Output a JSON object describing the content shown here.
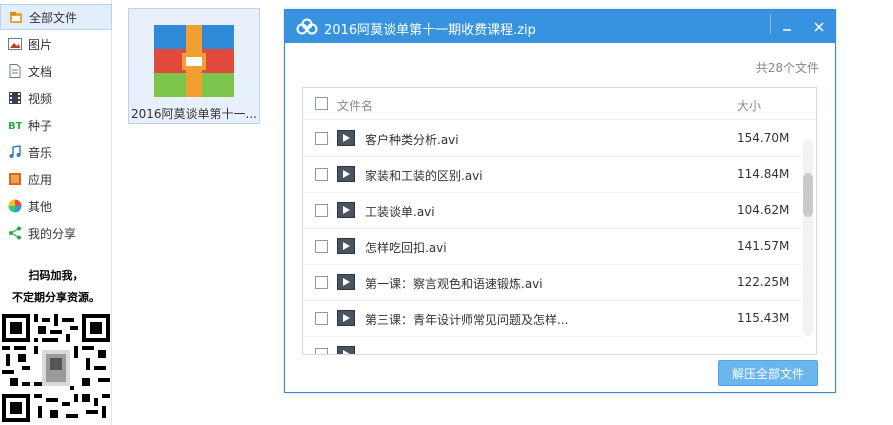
{
  "sidebar": {
    "items": [
      {
        "label": "全部文件",
        "icon": "all-files-icon"
      },
      {
        "label": "图片",
        "icon": "picture-icon"
      },
      {
        "label": "文档",
        "icon": "document-icon"
      },
      {
        "label": "视频",
        "icon": "video-icon"
      },
      {
        "label": "种子",
        "icon": "bt-icon"
      },
      {
        "label": "音乐",
        "icon": "music-icon"
      },
      {
        "label": "应用",
        "icon": "app-icon"
      },
      {
        "label": "其他",
        "icon": "other-icon"
      },
      {
        "label": "我的分享",
        "icon": "share-icon"
      }
    ],
    "promo_line1": "扫码加我，",
    "promo_line2": "不定期分享资源。"
  },
  "file_tile": {
    "name": "2016阿莫谈单第十一..."
  },
  "dialog": {
    "title": "2016阿莫谈单第十一期收费课程.zip",
    "file_count": "共28个文件",
    "header_name": "文件名",
    "header_size": "大小",
    "extract_label": "解压全部文件",
    "files": [
      {
        "name": "客户种类分析.avi",
        "size": "154.70M"
      },
      {
        "name": "家装和工装的区别.avi",
        "size": "114.84M"
      },
      {
        "name": "工装谈单.avi",
        "size": "104.62M"
      },
      {
        "name": "怎样吃回扣.avi",
        "size": "141.57M"
      },
      {
        "name": "第一课：察言观色和语速锻炼.avi",
        "size": "122.25M"
      },
      {
        "name": "第三课：青年设计师常见问题及怎样...",
        "size": "115.43M"
      }
    ]
  },
  "colors": {
    "titlebar": "#3793e0",
    "selected_bg": "#e2eefb",
    "extract_button": "#6cb6ef"
  }
}
